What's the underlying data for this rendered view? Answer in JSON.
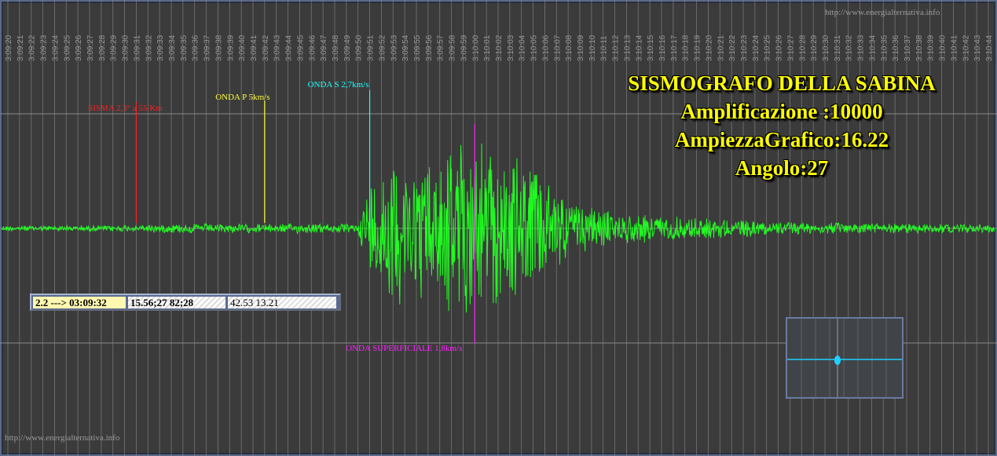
{
  "chart_data": {
    "type": "line",
    "title": "SISMOGRAFO DELLA SABINA",
    "subtitle_lines": [
      "Amplificazione :10000",
      "AmpiezzaGrafico:16.22",
      "Angolo:27"
    ],
    "xlabel": "",
    "ylabel": "",
    "grid": true,
    "time_ticks": [
      "3:09:20",
      "3:09:21",
      "3:09:22",
      "3:09:23",
      "3:09:24",
      "3:09:25",
      "3:09:26",
      "3:09:27",
      "3:09:28",
      "3:09:29",
      "3:09:30",
      "3:09:31",
      "3:09:32",
      "3:09:33",
      "3:09:34",
      "3:09:35",
      "3:09:36",
      "3:09:37",
      "3:09:38",
      "3:09:39",
      "3:09:40",
      "3:09:41",
      "3:09:42",
      "3:09:43",
      "3:09:44",
      "3:09:45",
      "3:09:46",
      "3:09:47",
      "3:09:48",
      "3:09:49",
      "3:09:50",
      "3:09:51",
      "3:09:52",
      "3:09:53",
      "3:09:54",
      "3:09:55",
      "3:09:56",
      "3:09:57",
      "3:09:58",
      "3:09:59",
      "3:10:00",
      "3:10:01",
      "3:10:02",
      "3:10:03",
      "3:10:04",
      "3:10:05",
      "3:10:06",
      "3:10:07",
      "3:10:08",
      "3:10:09",
      "3:10:10",
      "3:10:11",
      "3:10:12",
      "3:10:13",
      "3:10:14",
      "3:10:15",
      "3:10:16",
      "3:10:17",
      "3:10:18",
      "3:10:19",
      "3:10:20",
      "3:10:21",
      "3:10:22",
      "3:10:23",
      "3:10:24",
      "3:10:25",
      "3:10:26",
      "3:10:27",
      "3:10:28",
      "3:10:29",
      "3:10:30",
      "3:10:31",
      "3:10:32",
      "3:10:33",
      "3:10:34",
      "3:10:35",
      "3:10:36",
      "3:10:37",
      "3:10:38",
      "3:10:39",
      "3:10:40",
      "3:10:41",
      "3:10:42",
      "3:10:43",
      "3:10:44"
    ],
    "events": [
      {
        "label": "SISMA 2,3° a 55 Km",
        "time": "3:09:31",
        "color": "#ff2020"
      },
      {
        "label": "ONDA P 5km/s",
        "time": "3:09:42",
        "color": "#ffff40"
      },
      {
        "label": "ONDA S 2,7km/s",
        "time": "3:09:51",
        "color": "#20ffff"
      },
      {
        "label": "ONDA SUPERFICIALE 1,8km/s",
        "time": "3:10:00",
        "color": "#ff20ff"
      }
    ],
    "series": [
      {
        "color": "#20ff20",
        "envelope_time": [
          "3:09:20",
          "3:09:26",
          "3:09:31",
          "3:09:35",
          "3:09:42",
          "3:09:45",
          "3:09:50",
          "3:09:51",
          "3:09:53",
          "3:09:56",
          "3:09:58",
          "3:10:00",
          "3:10:02",
          "3:10:05",
          "3:10:08",
          "3:10:12",
          "3:10:20",
          "3:10:30",
          "3:10:44"
        ],
        "envelope_amplitude": [
          4,
          4,
          5,
          7,
          6,
          7,
          6,
          70,
          110,
          95,
          120,
          125,
          110,
          90,
          40,
          22,
          14,
          8,
          6
        ]
      }
    ]
  },
  "info_bar": {
    "cell_1": "2.2 ---> 03:09:32",
    "cell_2": "15.56;27 82;28",
    "cell_3": "42.53 13.21"
  },
  "watermarks": {
    "top_right": "http://www.energialternativa.info",
    "bottom_left": "http://www.energialternativa.info"
  },
  "colors": {
    "background": "#3b3b3b",
    "grid": "#8a8a8a",
    "trace": "#20ff20",
    "title": "#ffff00",
    "mini_trace": "#20d0ff"
  }
}
